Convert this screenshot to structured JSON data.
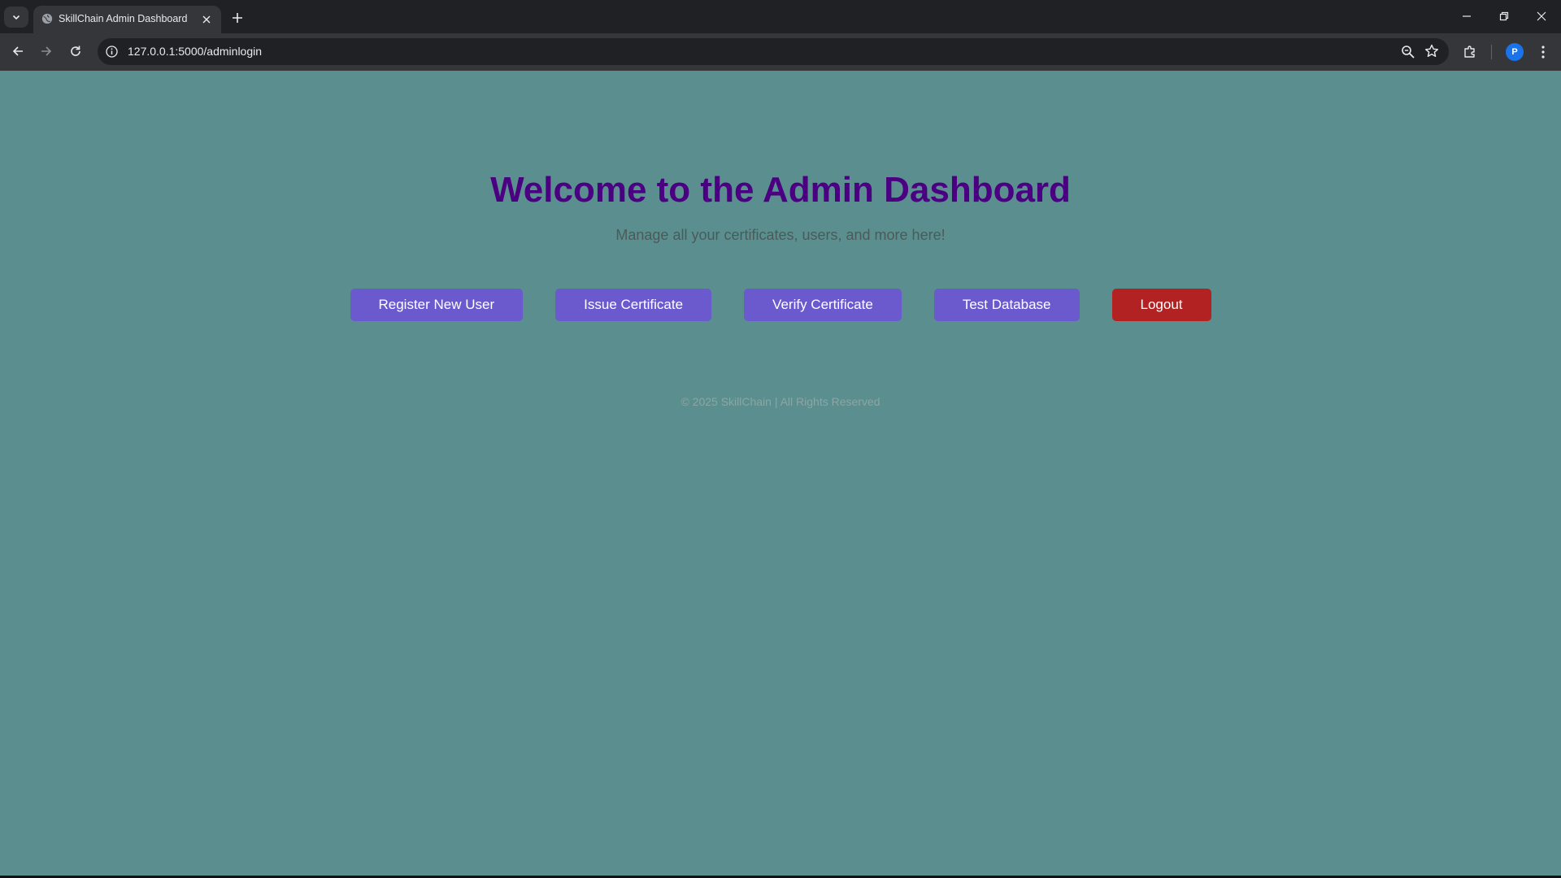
{
  "browser": {
    "tab_title": "SkillChain Admin Dashboard",
    "url": "127.0.0.1:5000/adminlogin",
    "profile_initial": "P"
  },
  "page": {
    "heading": "Welcome to the Admin Dashboard",
    "subtitle": "Manage all your certificates, users, and more here!",
    "buttons": [
      {
        "label": "Register New User"
      },
      {
        "label": "Issue Certificate"
      },
      {
        "label": "Verify Certificate"
      },
      {
        "label": "Test Database"
      },
      {
        "label": "Logout"
      }
    ],
    "footer": "© 2025 SkillChain | All Rights Reserved"
  },
  "colors": {
    "page_background": "#5b8f8f",
    "heading": "#4b0082",
    "primary_button": "#6a5acd",
    "logout_button": "#b22222"
  }
}
